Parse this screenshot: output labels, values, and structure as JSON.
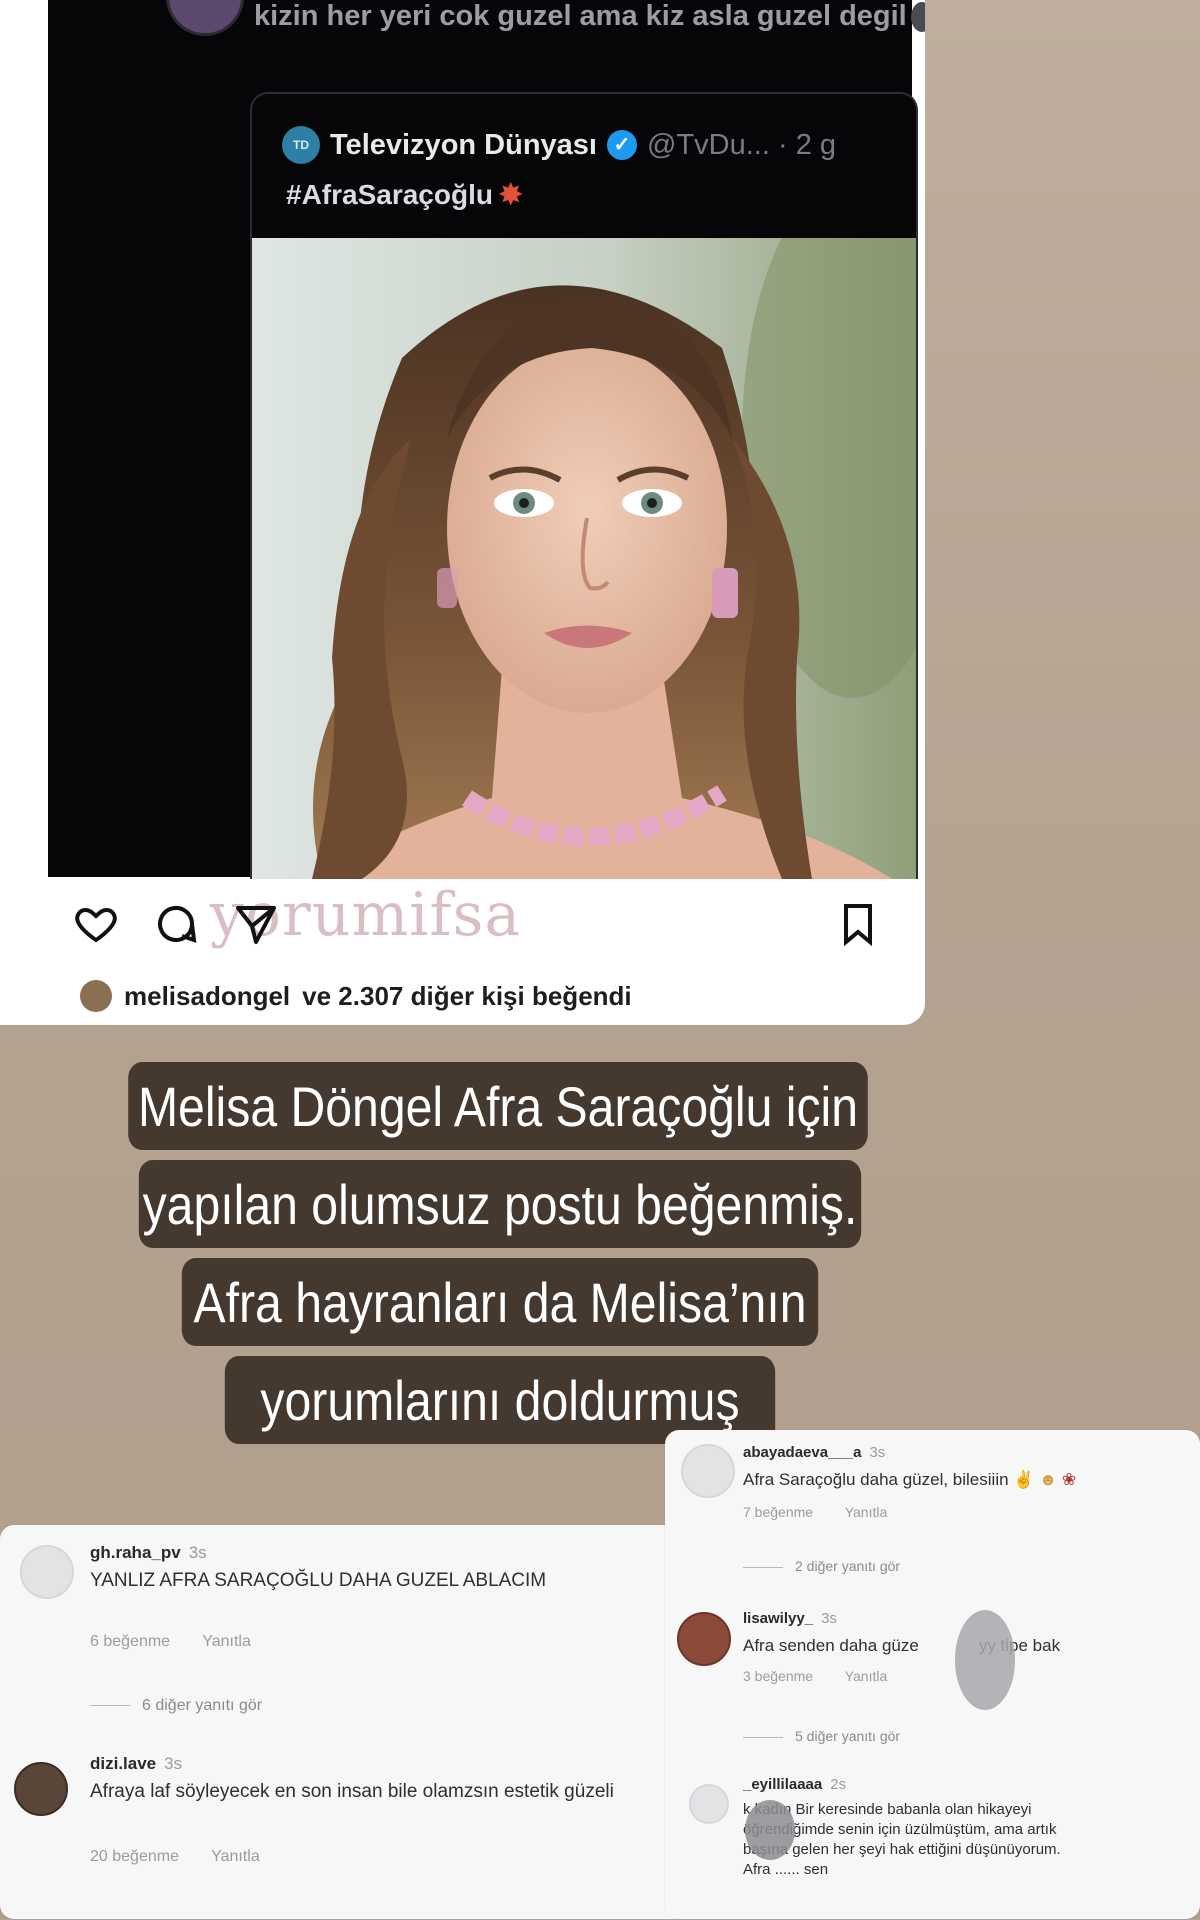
{
  "post": {
    "reply_text": "kizin her yeri cok guzel ama kiz asla guzel degil",
    "quote": {
      "source_name": "Televizyon Dünyası",
      "handle": "@TvDu...",
      "time": "2 g",
      "hashtag": "#AfraSaraçoğlu",
      "logo_text": "TD"
    },
    "watermark": "yorumifsa",
    "likes_user": "melisadongel",
    "likes_rest": "ve 2.307 diğer kişi beğendi",
    "icons": [
      "heart-icon",
      "comment-icon",
      "share-icon",
      "bookmark-icon",
      "verified-badge-icon"
    ]
  },
  "caption": {
    "lines": [
      "Melisa Döngel Afra Saraçoğlu için",
      "yapılan olumsuz postu beğenmiş.",
      "Afra hayranları da Melisa’nın",
      "yorumlarını doldurmuş"
    ]
  },
  "comments_left": [
    {
      "user": "gh.raha_pv",
      "time": "3s",
      "text": "YANLIZ AFRA SARAÇOĞLU DAHA GUZEL ABLACIM",
      "likes": "6 beğenme",
      "reply": "Yanıtla",
      "more": "6 diğer yanıtı gör"
    },
    {
      "user": "dizi.lave",
      "time": "3s",
      "text": "Afraya laf söyleyecek en son insan bile olamzsın estetik güzeli",
      "likes": "20 beğenme",
      "reply": "Yanıtla"
    }
  ],
  "comments_right": [
    {
      "user": "abayadaeva___a",
      "time": "3s",
      "text": "Afra Saraçoğlu daha güzel, bilesiiin",
      "likes": "7 beğenme",
      "reply": "Yanıtla",
      "more": "2 diğer yanıtı gör"
    },
    {
      "user": "lisawilyy_",
      "time": "3s",
      "text_a": "Afra senden daha güze",
      "text_b": "yy tipe bak",
      "likes": "3 beğenme",
      "reply": "Yanıtla",
      "more": "5 diğer yanıtı gör"
    },
    {
      "user": "_eyillilaaaa",
      "time": "2s",
      "text_lines": [
        "k kadın Bir keresinde babanla olan hikayeyi",
        "öğrendiğimde senin için üzülmüştüm, ama artık",
        "başına gelen her şeyi hak ettiğini düşünüyorum.",
        "Afra ...... sen"
      ]
    }
  ],
  "colors": {
    "background": "#b9a796",
    "caption_box": "#45382f",
    "card": "#ffffff",
    "post_dark": "#060608",
    "verified": "#1d9bf0"
  }
}
